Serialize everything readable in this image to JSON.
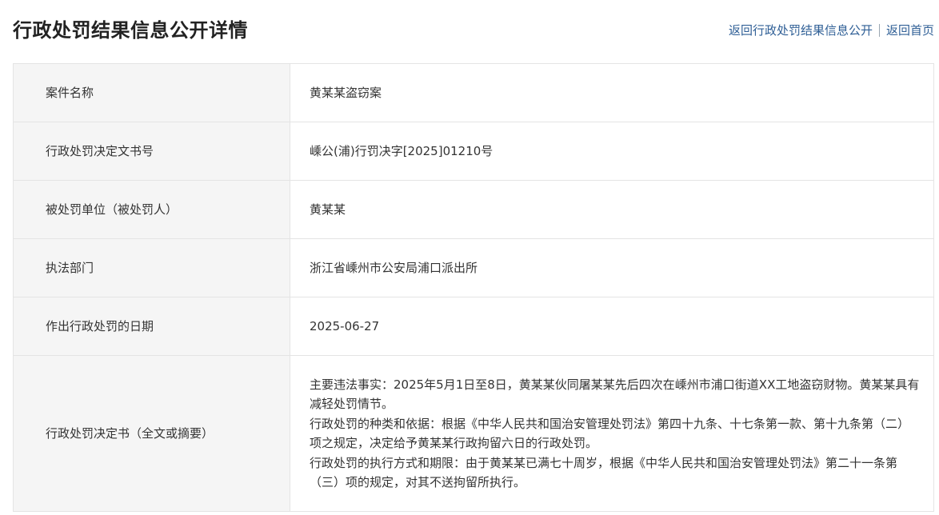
{
  "header": {
    "title": "行政处罚结果信息公开详情",
    "back_to_list_link": "返回行政处罚结果信息公开",
    "back_to_home_link": "返回首页"
  },
  "details": {
    "case_name": {
      "label": "案件名称",
      "value": "黄某某盗窃案"
    },
    "document_number": {
      "label": "行政处罚决定文书号",
      "value": "嵊公(浦)行罚决字[2025]01210号"
    },
    "penalized_party": {
      "label": "被处罚单位（被处罚人）",
      "value": "黄某某"
    },
    "enforcement_department": {
      "label": "执法部门",
      "value": "浙江省嵊州市公安局浦口派出所"
    },
    "decision_date": {
      "label": "作出行政处罚的日期",
      "value": "2025-06-27"
    },
    "decision_document": {
      "label": "行政处罚决定书（全文或摘要）",
      "paragraphs": [
        "主要违法事实：2025年5月1日至8日，黄某某伙同屠某某先后四次在嵊州市浦口街道XX工地盗窃财物。黄某某具有减轻处罚情节。",
        "行政处罚的种类和依据：根据《中华人民共和国治安管理处罚法》第四十九条、十七条第一款、第十九条第（二）项之规定，决定给予黄某某行政拘留六日的行政处罚。",
        "行政处罚的执行方式和期限：由于黄某某已满七十周岁，根据《中华人民共和国治安管理处罚法》第二十一条第（三）项的规定，对其不送拘留所执行。"
      ]
    }
  },
  "colors": {
    "link": "#2f5f96",
    "label_background": "#f5f5f5",
    "border": "#e4e4e4",
    "title": "#222222",
    "text": "#333333"
  }
}
